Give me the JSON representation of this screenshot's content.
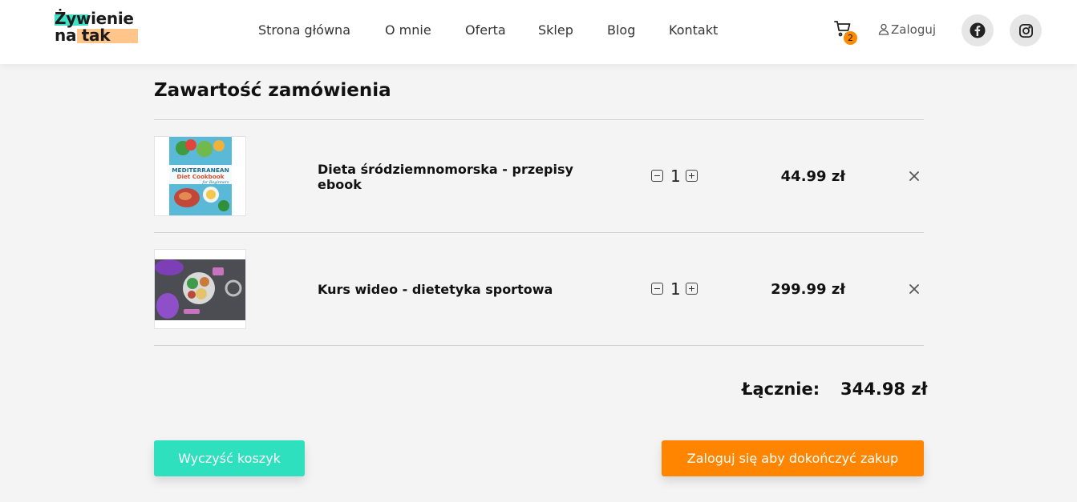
{
  "header": {
    "logo_line1": "Żywienie",
    "logo_line2": "na tak",
    "nav": [
      "Strona główna",
      "O mnie",
      "Oferta",
      "Sklep",
      "Blog",
      "Kontakt"
    ],
    "cart_count": "2",
    "login_label": "Zaloguj",
    "colors": {
      "accent_teal": "#3fe0c6",
      "accent_orange": "#ffc58b"
    }
  },
  "order": {
    "title": "Zawartość zamówienia",
    "items": [
      {
        "name": "Dieta śródziemnomorska - przepisy ebook",
        "qty": "1",
        "price": "44.99 zł",
        "cover_text": [
          "MEDITERRANEAN",
          "Diet Cookbook",
          "for Beginners"
        ]
      },
      {
        "name": "Kurs wideo - dietetyka sportowa",
        "qty": "1",
        "price": "299.99 zł"
      }
    ],
    "total_label": "Łącznie:",
    "total_value": "344.98 zł"
  },
  "actions": {
    "clear_label": "Wyczyść koszyk",
    "checkout_label": "Zaloguj się aby dokończyć zakup",
    "clear_color": "#2ee0bd",
    "checkout_color": "#ff8500"
  }
}
